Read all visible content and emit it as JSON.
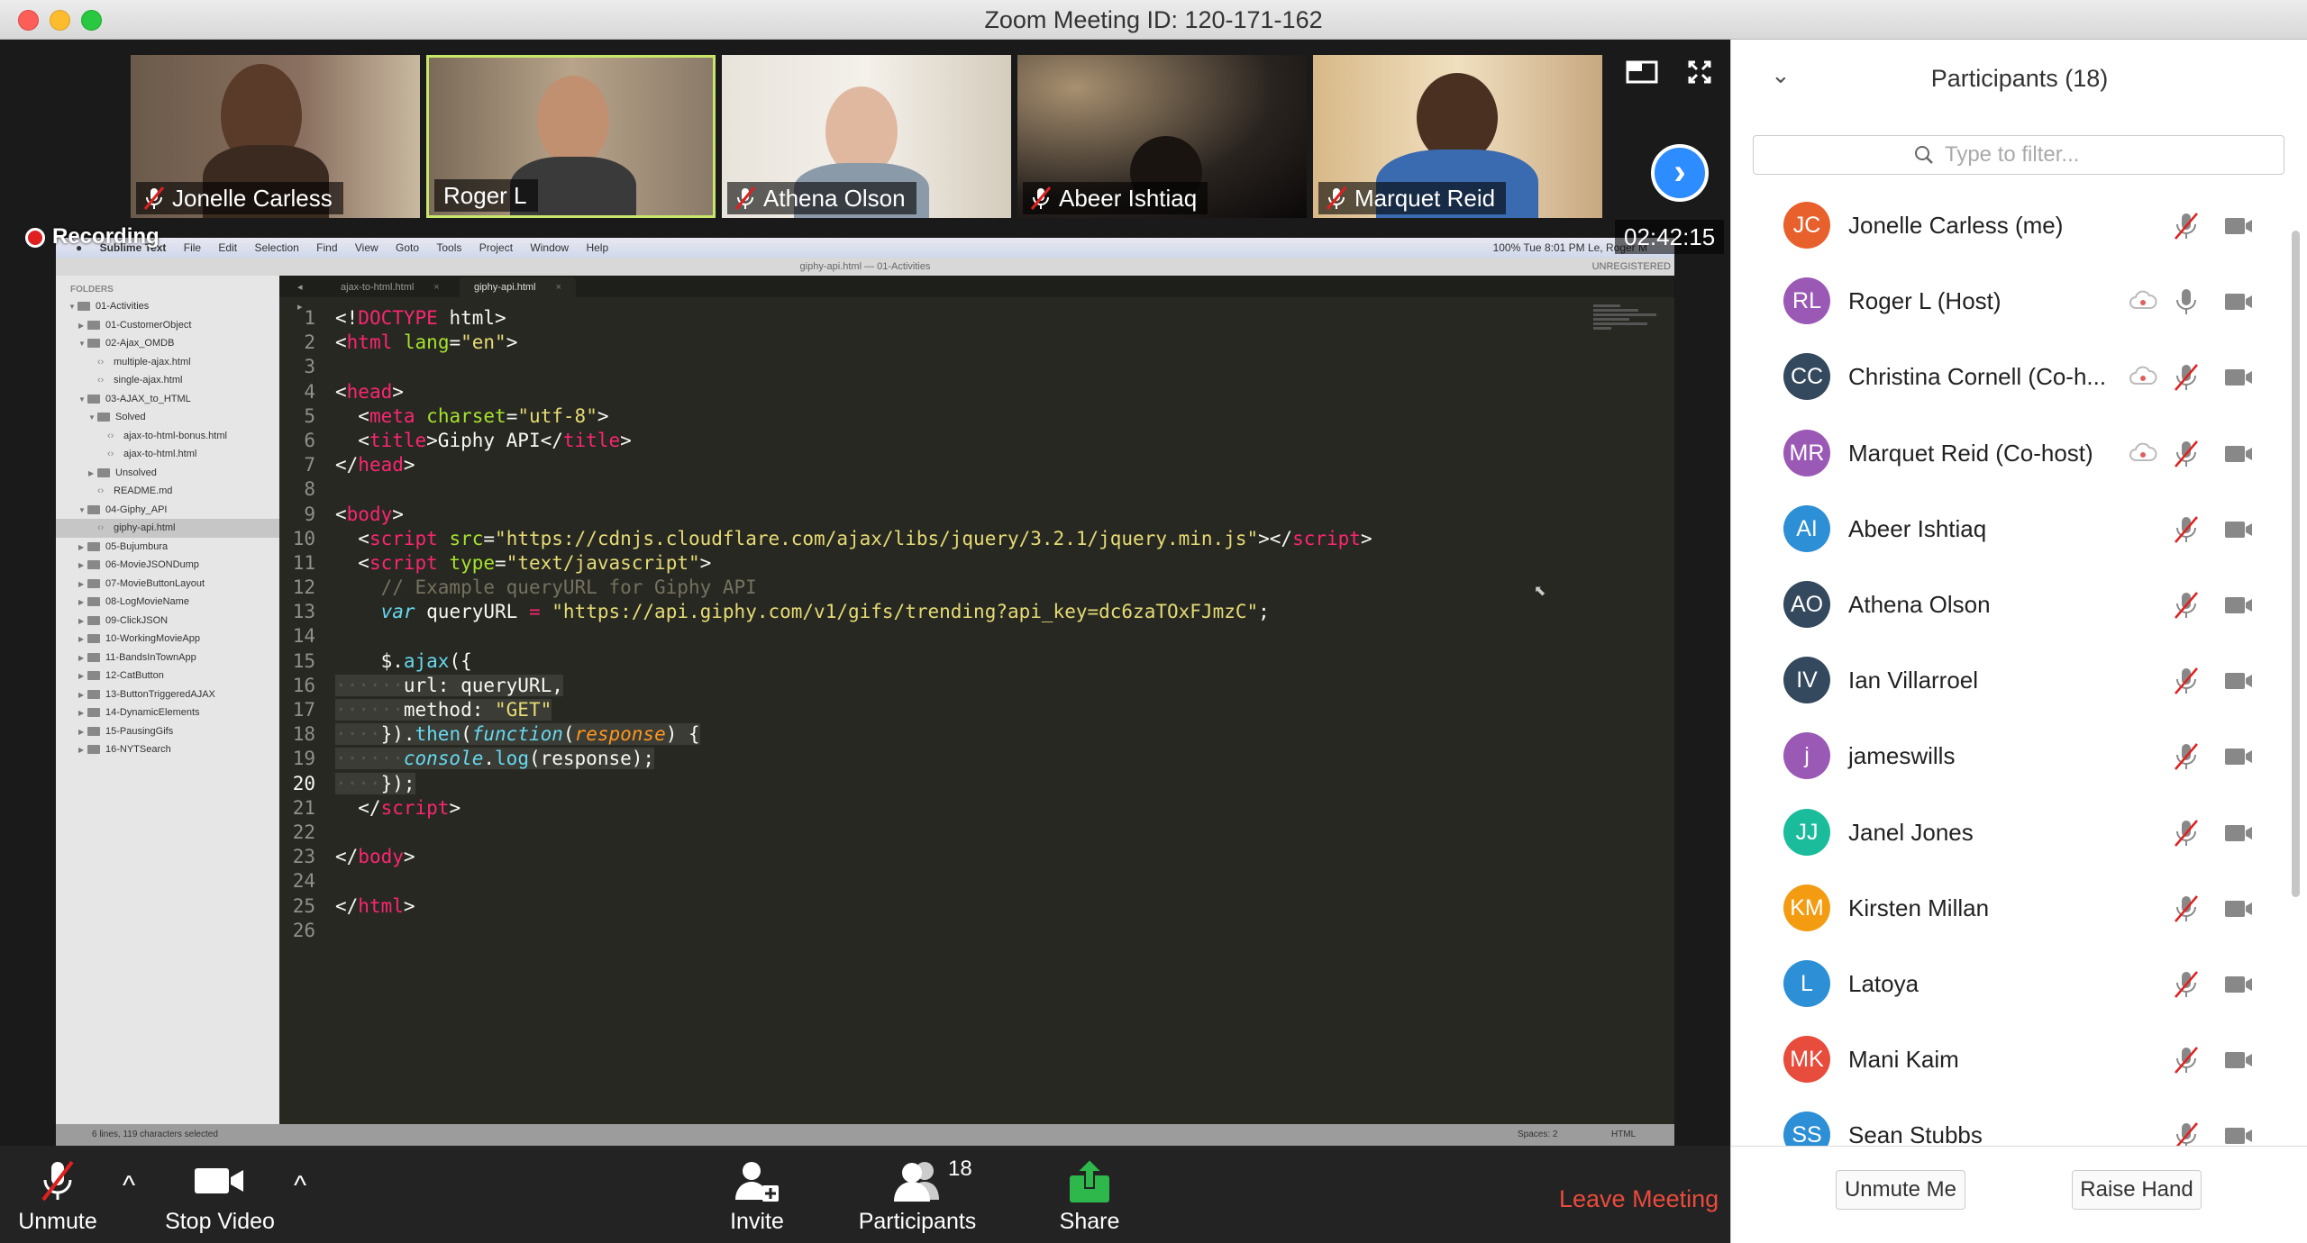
{
  "window": {
    "title": "Zoom Meeting ID: 120-171-162"
  },
  "video_tiles": [
    {
      "name": "Jonelle Carless",
      "muted": true,
      "active": false
    },
    {
      "name": "Roger L",
      "muted": false,
      "active": true
    },
    {
      "name": "Athena Olson",
      "muted": true,
      "active": false
    },
    {
      "name": "Abeer Ishtiaq",
      "muted": true,
      "active": false
    },
    {
      "name": "Marquet Reid",
      "muted": true,
      "active": false
    }
  ],
  "recording": {
    "label": "Recording",
    "timer": "02:42:15"
  },
  "shared_screen": {
    "menu": [
      "Sublime Text",
      "File",
      "Edit",
      "Selection",
      "Find",
      "View",
      "Goto",
      "Tools",
      "Project",
      "Window",
      "Help"
    ],
    "menu_right": "100%   Tue 8:01 PM   Le, Roger M",
    "file_title": "giphy-api.html — 01-Activities",
    "unregistered": "UNREGISTERED",
    "folders_header": "FOLDERS",
    "tree": [
      {
        "label": "01-Activities",
        "type": "folder",
        "depth": 0,
        "open": true
      },
      {
        "label": "01-CustomerObject",
        "type": "folder",
        "depth": 1,
        "open": false
      },
      {
        "label": "02-Ajax_OMDB",
        "type": "folder",
        "depth": 1,
        "open": true
      },
      {
        "label": "multiple-ajax.html",
        "type": "file",
        "depth": 2
      },
      {
        "label": "single-ajax.html",
        "type": "file",
        "depth": 2
      },
      {
        "label": "03-AJAX_to_HTML",
        "type": "folder",
        "depth": 1,
        "open": true
      },
      {
        "label": "Solved",
        "type": "folder",
        "depth": 2,
        "open": true
      },
      {
        "label": "ajax-to-html-bonus.html",
        "type": "file",
        "depth": 3
      },
      {
        "label": "ajax-to-html.html",
        "type": "file",
        "depth": 3
      },
      {
        "label": "Unsolved",
        "type": "folder",
        "depth": 2,
        "open": false
      },
      {
        "label": "README.md",
        "type": "file",
        "depth": 2
      },
      {
        "label": "04-Giphy_API",
        "type": "folder",
        "depth": 1,
        "open": true
      },
      {
        "label": "giphy-api.html",
        "type": "file",
        "depth": 2,
        "selected": true
      },
      {
        "label": "05-Bujumbura",
        "type": "folder",
        "depth": 1,
        "open": false
      },
      {
        "label": "06-MovieJSONDump",
        "type": "folder",
        "depth": 1,
        "open": false
      },
      {
        "label": "07-MovieButtonLayout",
        "type": "folder",
        "depth": 1,
        "open": false
      },
      {
        "label": "08-LogMovieName",
        "type": "folder",
        "depth": 1,
        "open": false
      },
      {
        "label": "09-ClickJSON",
        "type": "folder",
        "depth": 1,
        "open": false
      },
      {
        "label": "10-WorkingMovieApp",
        "type": "folder",
        "depth": 1,
        "open": false
      },
      {
        "label": "11-BandsInTownApp",
        "type": "folder",
        "depth": 1,
        "open": false
      },
      {
        "label": "12-CatButton",
        "type": "folder",
        "depth": 1,
        "open": false
      },
      {
        "label": "13-ButtonTriggeredAJAX",
        "type": "folder",
        "depth": 1,
        "open": false
      },
      {
        "label": "14-DynamicElements",
        "type": "folder",
        "depth": 1,
        "open": false
      },
      {
        "label": "15-PausingGifs",
        "type": "folder",
        "depth": 1,
        "open": false
      },
      {
        "label": "16-NYTSearch",
        "type": "folder",
        "depth": 1,
        "open": false
      }
    ],
    "tabs": [
      {
        "label": "ajax-to-html.html",
        "active": false
      },
      {
        "label": "giphy-api.html",
        "active": true
      }
    ],
    "status_left": "6 lines, 119 characters selected",
    "status_spaces": "Spaces: 2",
    "status_syntax": "HTML"
  },
  "code_lines": [
    [
      {
        "t": "<!"
      },
      {
        "t": "DOCTYPE",
        "c": "kw"
      },
      {
        "t": " html>"
      }
    ],
    [
      {
        "t": "<"
      },
      {
        "t": "html",
        "c": "kw"
      },
      {
        "t": " "
      },
      {
        "t": "lang",
        "c": "attr"
      },
      {
        "t": "="
      },
      {
        "t": "\"en\"",
        "c": "str"
      },
      {
        "t": ">"
      }
    ],
    [],
    [
      {
        "t": "<"
      },
      {
        "t": "head",
        "c": "kw"
      },
      {
        "t": ">"
      }
    ],
    [
      {
        "t": "  <"
      },
      {
        "t": "meta",
        "c": "kw"
      },
      {
        "t": " "
      },
      {
        "t": "charset",
        "c": "attr"
      },
      {
        "t": "="
      },
      {
        "t": "\"utf-8\"",
        "c": "str"
      },
      {
        "t": ">"
      }
    ],
    [
      {
        "t": "  <"
      },
      {
        "t": "title",
        "c": "kw"
      },
      {
        "t": ">Giphy API</"
      },
      {
        "t": "title",
        "c": "kw"
      },
      {
        "t": ">"
      }
    ],
    [
      {
        "t": "</"
      },
      {
        "t": "head",
        "c": "kw"
      },
      {
        "t": ">"
      }
    ],
    [],
    [
      {
        "t": "<"
      },
      {
        "t": "body",
        "c": "kw"
      },
      {
        "t": ">"
      }
    ],
    [
      {
        "t": "  <"
      },
      {
        "t": "script",
        "c": "kw"
      },
      {
        "t": " "
      },
      {
        "t": "src",
        "c": "attr"
      },
      {
        "t": "="
      },
      {
        "t": "\"https://cdnjs.cloudflare.com/ajax/libs/jquery/3.2.1/jquery.min.js\"",
        "c": "str"
      },
      {
        "t": "></"
      },
      {
        "t": "script",
        "c": "kw"
      },
      {
        "t": ">"
      }
    ],
    [
      {
        "t": "  <"
      },
      {
        "t": "script",
        "c": "kw"
      },
      {
        "t": " "
      },
      {
        "t": "type",
        "c": "attr"
      },
      {
        "t": "="
      },
      {
        "t": "\"text/javascript\"",
        "c": "str"
      },
      {
        "t": ">"
      }
    ],
    [
      {
        "t": "    "
      },
      {
        "t": "// Example queryURL for Giphy API",
        "c": "cm"
      }
    ],
    [
      {
        "t": "    "
      },
      {
        "t": "var",
        "c": "fn"
      },
      {
        "t": " queryURL "
      },
      {
        "t": "=",
        "c": "kw"
      },
      {
        "t": " "
      },
      {
        "t": "\"https://api.giphy.com/v1/gifs/trending?api_key=dc6zaTOxFJmzC\"",
        "c": "str"
      },
      {
        "t": ";"
      }
    ],
    [],
    [
      {
        "t": "    $."
      },
      {
        "t": "ajax",
        "c": "blue"
      },
      {
        "t": "({"
      }
    ],
    [
      {
        "t": "······",
        "c": "dots",
        "s": 1
      },
      {
        "t": "url: queryURL,",
        "s": 1
      }
    ],
    [
      {
        "t": "······",
        "c": "dots",
        "s": 1
      },
      {
        "t": "method: ",
        "s": 1
      },
      {
        "t": "\"GET\"",
        "c": "str",
        "s": 1
      }
    ],
    [
      {
        "t": "····",
        "c": "dots",
        "s": 1
      },
      {
        "t": "}).",
        "s": 1
      },
      {
        "t": "then",
        "c": "blue",
        "s": 1
      },
      {
        "t": "(",
        "s": 1
      },
      {
        "t": "function",
        "c": "fn",
        "s": 1
      },
      {
        "t": "(",
        "s": 1
      },
      {
        "t": "response",
        "c": "par",
        "s": 1
      },
      {
        "t": ") {",
        "s": 1
      }
    ],
    [
      {
        "t": "······",
        "c": "dots",
        "s": 1
      },
      {
        "t": "console",
        "c": "fn",
        "s": 1
      },
      {
        "t": ".",
        "s": 1
      },
      {
        "t": "log",
        "c": "blue",
        "s": 1
      },
      {
        "t": "(response);",
        "s": 1
      }
    ],
    [
      {
        "t": "····",
        "c": "dots",
        "s": 1
      },
      {
        "t": "});",
        "s": 1
      }
    ],
    [
      {
        "t": "  </"
      },
      {
        "t": "script",
        "c": "kw"
      },
      {
        "t": ">"
      }
    ],
    [],
    [
      {
        "t": "</"
      },
      {
        "t": "body",
        "c": "kw"
      },
      {
        "t": ">"
      }
    ],
    [],
    [
      {
        "t": "</"
      },
      {
        "t": "html",
        "c": "kw"
      },
      {
        "t": ">"
      }
    ],
    []
  ],
  "toolbar": {
    "unmute": "Unmute",
    "stop_video": "Stop Video",
    "invite": "Invite",
    "participants": "Participants",
    "participants_count": "18",
    "share": "Share",
    "leave": "Leave Meeting"
  },
  "panel": {
    "title": "Participants (18)",
    "filter_placeholder": "Type to filter...",
    "participants": [
      {
        "initials": "JC",
        "name": "Jonelle Carless (me)",
        "color": "#e8602c",
        "cloud": false,
        "muted": true
      },
      {
        "initials": "RL",
        "name": "Roger L (Host)",
        "color": "#9b59b6",
        "cloud": true,
        "muted": false
      },
      {
        "initials": "CC",
        "name": "Christina Cornell (Co-h...",
        "color": "#34495e",
        "cloud": true,
        "muted": true
      },
      {
        "initials": "MR",
        "name": "Marquet Reid (Co-host)",
        "color": "#9b59b6",
        "cloud": true,
        "muted": true
      },
      {
        "initials": "AI",
        "name": "Abeer Ishtiaq",
        "color": "#2d8fd5",
        "cloud": false,
        "muted": true
      },
      {
        "initials": "AO",
        "name": "Athena Olson",
        "color": "#34495e",
        "cloud": false,
        "muted": true
      },
      {
        "initials": "IV",
        "name": "Ian Villarroel",
        "color": "#34495e",
        "cloud": false,
        "muted": true
      },
      {
        "initials": "j",
        "name": "jameswills",
        "color": "#9b59b6",
        "cloud": false,
        "muted": true
      },
      {
        "initials": "JJ",
        "name": "Janel Jones",
        "color": "#1abc9c",
        "cloud": false,
        "muted": true
      },
      {
        "initials": "KM",
        "name": "Kirsten Millan",
        "color": "#f39c12",
        "cloud": false,
        "muted": true
      },
      {
        "initials": "L",
        "name": "Latoya",
        "color": "#2d8fd5",
        "cloud": false,
        "muted": true
      },
      {
        "initials": "MK",
        "name": "Mani Kaim",
        "color": "#e74c3c",
        "cloud": false,
        "muted": true
      },
      {
        "initials": "SS",
        "name": "Sean Stubbs",
        "color": "#2d8fd5",
        "cloud": false,
        "muted": true
      }
    ],
    "unmute_me": "Unmute Me",
    "raise_hand": "Raise Hand"
  }
}
